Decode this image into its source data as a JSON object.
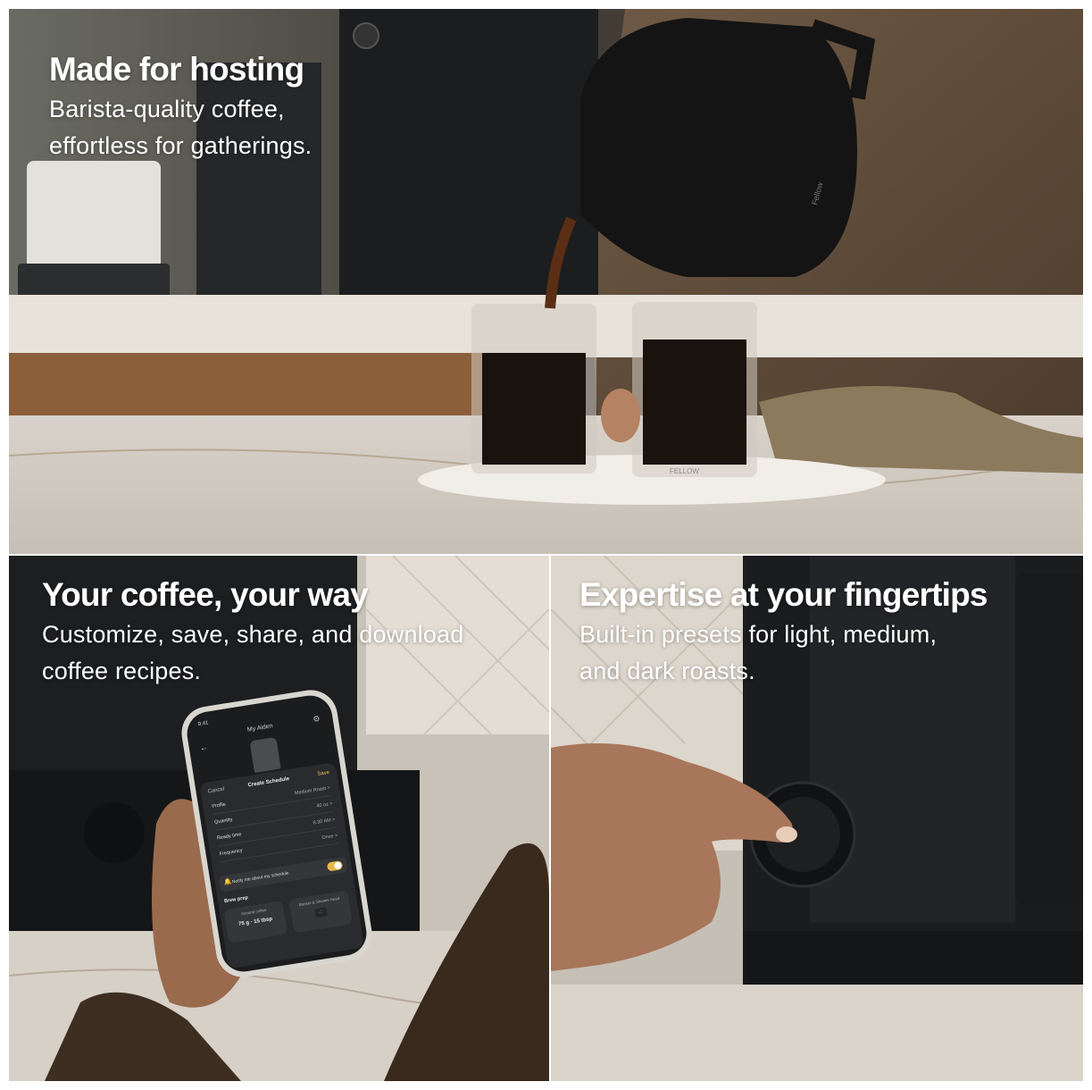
{
  "panels": {
    "hosting": {
      "headline": "Made for hosting",
      "sub_line1": "Barista-quality coffee,",
      "sub_line2": "effortless for gatherings.",
      "kettle_brand": "Fellow",
      "glass_brand": "FELLOW"
    },
    "custom": {
      "headline": "Your coffee, your way",
      "sub_line1": "Customize, save, share, and download",
      "sub_line2": "coffee recipes."
    },
    "expertise": {
      "headline": "Expertise at your fingertips",
      "sub_line1": "Built-in presets for light, medium,",
      "sub_line2": "and dark roasts."
    }
  },
  "phone_app": {
    "time": "9:41",
    "title": "My Aiden",
    "back_icon": "arrow-left-icon",
    "settings_icon": "gear-icon",
    "sheet": {
      "cancel": "Cancel",
      "title": "Create Schedule",
      "save": "Save",
      "rows": [
        {
          "label": "Profile",
          "value": "Medium Roast  >"
        },
        {
          "label": "Quantity",
          "value": "40 oz  >"
        },
        {
          "label": "Ready time",
          "value": "6:30 AM  >"
        },
        {
          "label": "Frequency",
          "value": "Once  >"
        }
      ],
      "notify_text": "Notify me about my schedule",
      "notify_on": true,
      "brew_prep_label": "Brew prep",
      "ground_coffee_label": "Ground coffee",
      "ground_coffee_value": "75 g · 15 tbsp",
      "basket_label": "Basket & Shower head"
    }
  },
  "colors": {
    "toggle_accent": "#e7b84a",
    "text": "#ffffff"
  }
}
